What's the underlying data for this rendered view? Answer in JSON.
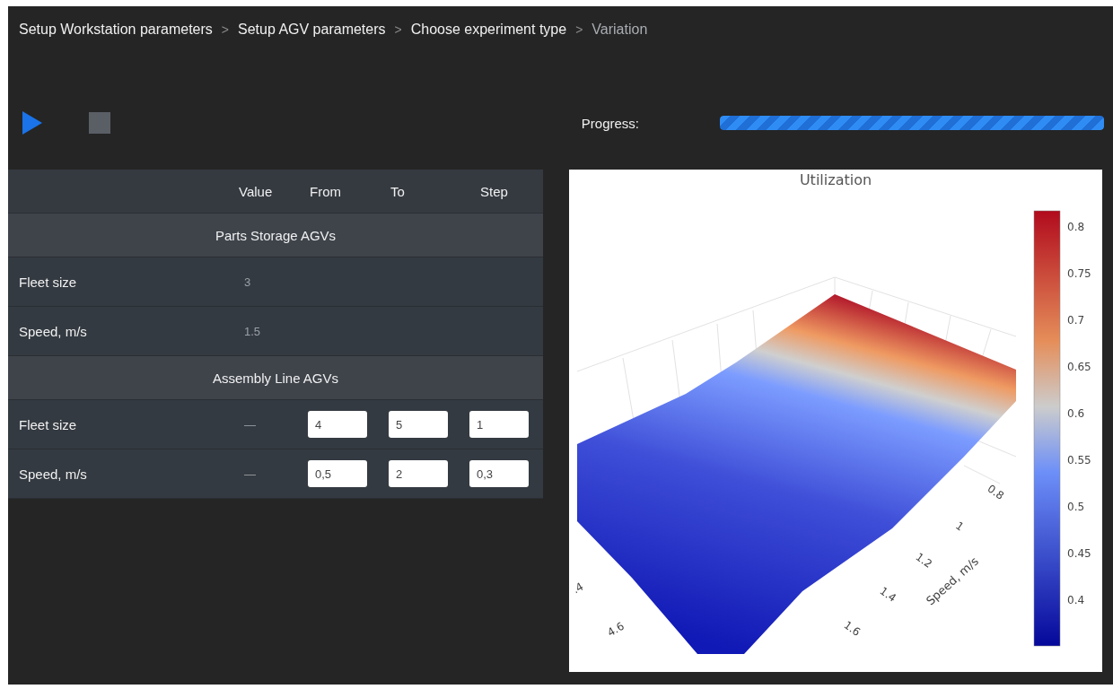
{
  "breadcrumbs": [
    {
      "kind": "link",
      "label": "Setup Workstation parameters",
      "selected": false
    },
    {
      "kind": "separator",
      "label": ">"
    },
    {
      "kind": "link",
      "label": "Setup AGV parameters",
      "selected": false
    },
    {
      "kind": "separator",
      "label": ">"
    },
    {
      "kind": "link",
      "label": "Choose experiment type",
      "selected": false
    },
    {
      "kind": "separator",
      "label": ">"
    },
    {
      "kind": "link",
      "label": "Variation",
      "selected": true
    }
  ],
  "controls": [
    {
      "kind": "play",
      "disabled": false
    },
    {
      "kind": "stop",
      "disabled": true
    }
  ],
  "progress": {
    "label": "Progress:",
    "level": 1
  },
  "table": {
    "columns": [
      "Value",
      "From",
      "To",
      "Step"
    ],
    "groups": [
      {
        "title": "Parts Storage AGVs",
        "rows": [
          {
            "kind": "fixed",
            "label": "Fleet size",
            "value": "3"
          },
          {
            "kind": "fixed",
            "label": "Speed, m/s",
            "value": "1.5"
          }
        ]
      },
      {
        "title": "Assembly Line AGVs",
        "rows": [
          {
            "kind": "range",
            "label": "Fleet size",
            "value": "—",
            "from": "4",
            "to": "5",
            "step": "1"
          },
          {
            "kind": "range",
            "label": "Speed, m/s",
            "value": "—",
            "from": "0,5",
            "to": "2",
            "step": "0,3"
          }
        ]
      }
    ]
  },
  "chart": {
    "title": "Utilization",
    "colorbar_ticks": [
      "0.8",
      "0.75",
      "0.7",
      "0.65",
      "0.6",
      "0.55",
      "0.5",
      "0.45",
      "0.4"
    ],
    "speed_axis": {
      "title": "Speed, m/s",
      "ticks": [
        "0.8",
        "1",
        "1.2",
        "1.4",
        "1.6"
      ]
    },
    "fleet_axis": {
      "ticks": [
        ".4",
        "4.6"
      ]
    }
  }
}
